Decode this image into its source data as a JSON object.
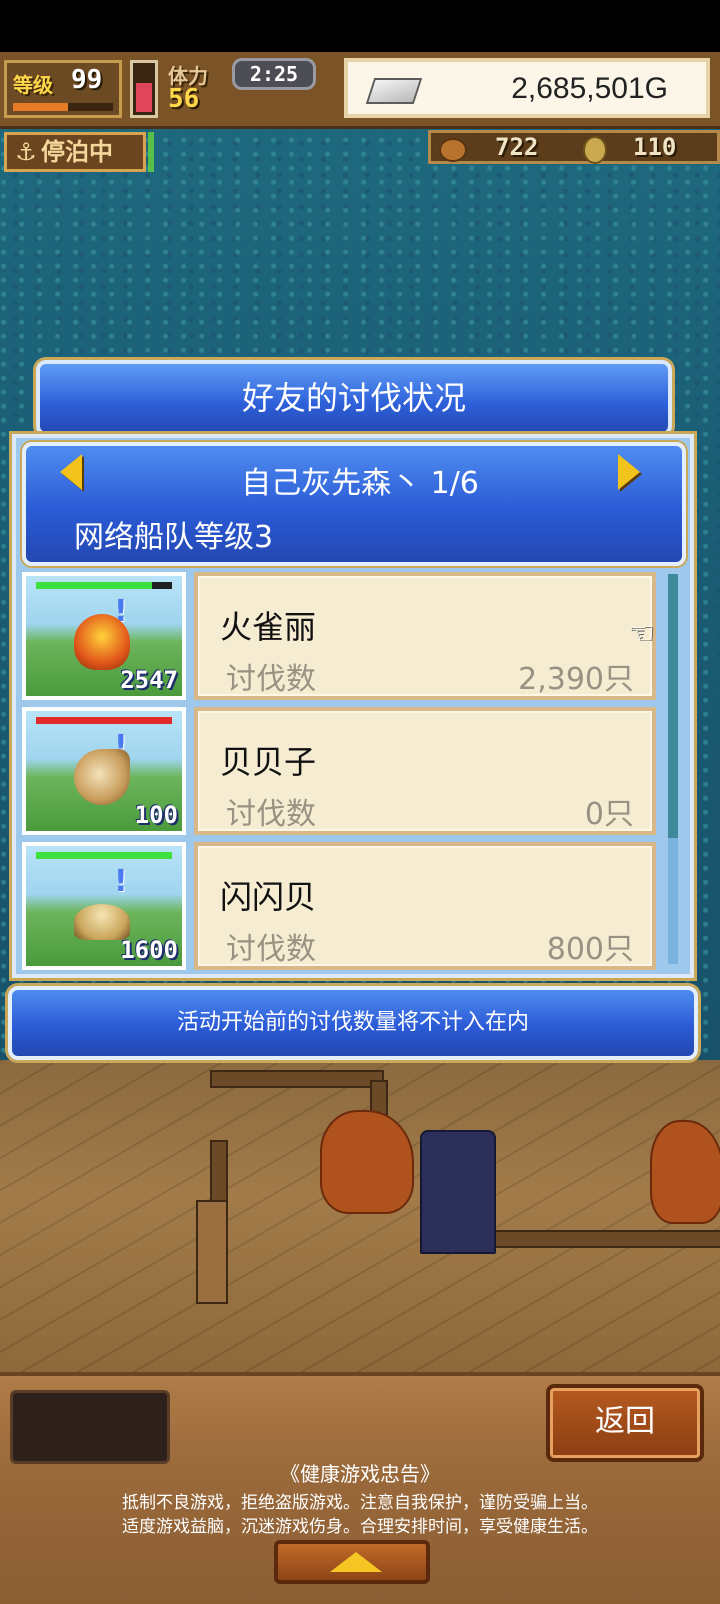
{
  "hud": {
    "level_label": "等级",
    "level_value": "99",
    "exp_fraction": 0.55,
    "stamina_label": "体力",
    "stamina_value": "56",
    "stamina_fraction": 0.62,
    "timer": "2:25",
    "gold": "2,685,501G",
    "status_label": "停泊中",
    "resources": [
      {
        "icon": "meat-icon",
        "value": "722"
      },
      {
        "icon": "medal-icon",
        "value": "110"
      }
    ]
  },
  "dialog": {
    "title": "好友的讨伐状况",
    "friend_name": "自己灰先森丶 1/6",
    "fleet_level": "网络船队等级3",
    "rows": [
      {
        "monster": "火雀丽",
        "kill_label": "讨伐数",
        "kill_value": "2,390只",
        "count": "2547",
        "hp_fraction": 0.85,
        "hp_color": "#3ee03e"
      },
      {
        "monster": "贝贝子",
        "kill_label": "讨伐数",
        "kill_value": "0只",
        "count": "100",
        "hp_fraction": 1.0,
        "hp_color": "#e22a2a"
      },
      {
        "monster": "闪闪贝",
        "kill_label": "讨伐数",
        "kill_value": "800只",
        "count": "1600",
        "hp_fraction": 1.0,
        "hp_color": "#3ee03e"
      }
    ],
    "notice": "活动开始前的讨伐数量将不计入在内"
  },
  "bottom": {
    "back_label": "返回",
    "health_title": "《健康游戏忠告》",
    "health_line1": "抵制不良游戏，拒绝盗版游戏。注意自我保护，谨防受骗上当。",
    "health_line2": "适度游戏益脑，沉迷游戏伤身。合理安排时间，享受健康生活。"
  },
  "colors": {
    "dialog_blue": "#2d5fd8",
    "gold_text": "#ffd84a",
    "card_bg": "#f6ecd2"
  }
}
